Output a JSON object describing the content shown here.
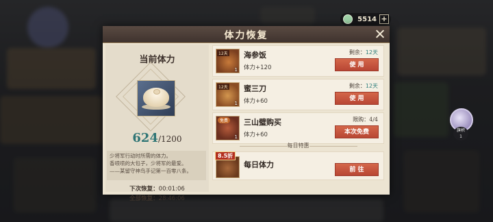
{
  "currency": {
    "icon": "jade-coin-icon",
    "amount": "5514",
    "plus": "+"
  },
  "side_badge": {
    "line1": "旗帜",
    "line2": "1"
  },
  "dialog": {
    "title": "体力恢复",
    "left": {
      "title": "当前体力",
      "current": "624",
      "max": "/1200",
      "description": [
        "少将军行动时所需的体力。",
        "香喷喷的大包子，少将军的最爱。",
        "——某留守神鸟手记第一百零八条。"
      ],
      "next_label": "下次恢复：",
      "next_value": "00:01:06",
      "full_label": "全部恢复：",
      "full_value": "28:46:06"
    },
    "items": [
      {
        "name": "海参饭",
        "effect": "体力+120",
        "tag": "12天",
        "qty": "1",
        "remain_label": "剩余：",
        "remain_value": "12天",
        "button": "使 用"
      },
      {
        "name": "蜜三刀",
        "effect": "体力+60",
        "tag": "12天",
        "qty": "1",
        "remain_label": "剩余：",
        "remain_value": "12天",
        "button": "使 用"
      },
      {
        "name": "三山璧购买",
        "effect": "体力+60",
        "tag": "免费",
        "qty": "1",
        "remain_label": "限购：",
        "remain_value": "4/4",
        "button": "本次免费"
      }
    ],
    "daily_divider": "每日特惠",
    "daily": {
      "discount": "8.5折",
      "name": "每日体力",
      "button": "前 往"
    }
  },
  "colors": {
    "accent_button": "#c9573e",
    "header": "#4a3c35",
    "teal_value": "#2f7f7c"
  }
}
